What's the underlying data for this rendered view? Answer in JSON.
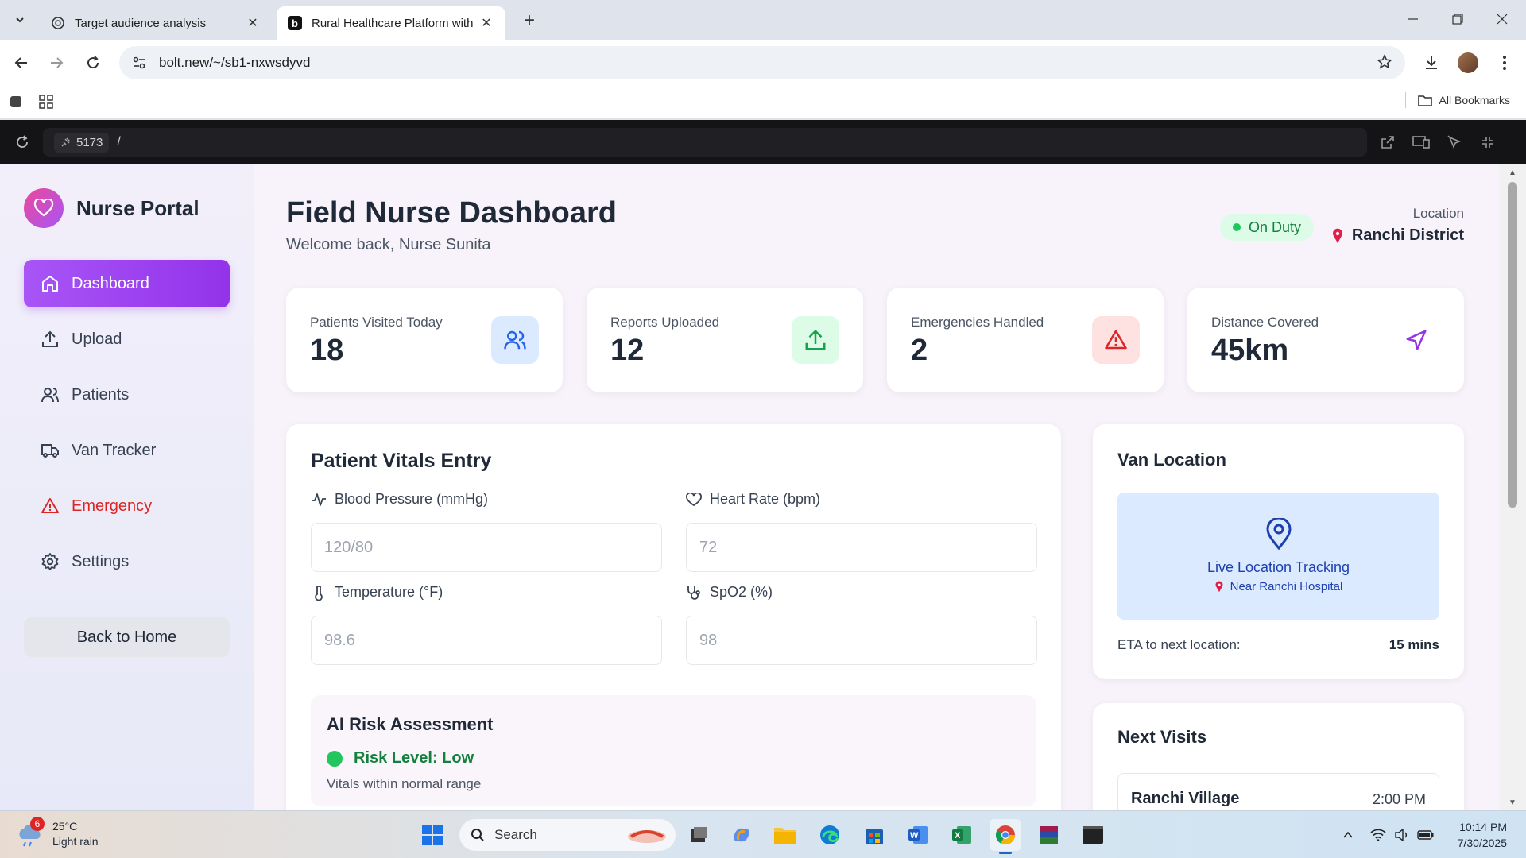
{
  "browser": {
    "tabs": [
      {
        "title": "Target audience analysis",
        "active": false
      },
      {
        "title": "Rural Healthcare Platform with",
        "active": true
      }
    ],
    "url": "bolt.new/~/sb1-nxwsdyvd",
    "bookmarks_label": "All Bookmarks"
  },
  "devbar": {
    "port": "5173",
    "path": "/"
  },
  "sidebar": {
    "brand": "Nurse Portal",
    "items": [
      {
        "label": "Dashboard",
        "icon": "home-icon",
        "active": true
      },
      {
        "label": "Upload",
        "icon": "upload-icon"
      },
      {
        "label": "Patients",
        "icon": "users-icon"
      },
      {
        "label": "Van Tracker",
        "icon": "truck-icon"
      },
      {
        "label": "Emergency",
        "icon": "alert-triangle-icon",
        "danger": true
      },
      {
        "label": "Settings",
        "icon": "gear-icon"
      }
    ],
    "back_home": "Back to Home"
  },
  "header": {
    "title": "Field Nurse Dashboard",
    "subtitle": "Welcome back, Nurse Sunita",
    "status": "On Duty",
    "location_label": "Location",
    "location_value": "Ranchi District"
  },
  "stats": [
    {
      "label": "Patients Visited Today",
      "value": "18",
      "icon": "users-icon",
      "color": "#2563eb",
      "bg": "#dbeafe"
    },
    {
      "label": "Reports Uploaded",
      "value": "12",
      "icon": "upload-icon",
      "color": "#16a34a",
      "bg": "#dcfce7"
    },
    {
      "label": "Emergencies Handled",
      "value": "2",
      "icon": "alert-triangle-icon",
      "color": "#dc2626",
      "bg": "#fee2e2"
    },
    {
      "label": "Distance Covered",
      "value": "45km",
      "icon": "navigation-icon",
      "color": "#9333ea",
      "bg": "#ffffff"
    }
  ],
  "vitals": {
    "title": "Patient Vitals Entry",
    "fields": [
      {
        "label": "Blood Pressure (mmHg)",
        "placeholder": "120/80",
        "icon": "activity-icon"
      },
      {
        "label": "Heart Rate (bpm)",
        "placeholder": "72",
        "icon": "heart-icon"
      },
      {
        "label": "Temperature (°F)",
        "placeholder": "98.6",
        "icon": "thermometer-icon"
      },
      {
        "label": "SpO2 (%)",
        "placeholder": "98",
        "icon": "stethoscope-icon"
      }
    ],
    "risk": {
      "title": "AI Risk Assessment",
      "level": "Risk Level: Low",
      "note": "Vitals within normal range"
    }
  },
  "van": {
    "title": "Van Location",
    "live": "Live Location Tracking",
    "near": "Near Ranchi Hospital",
    "eta_label": "ETA to next location:",
    "eta_value": "15 mins"
  },
  "next_visits": {
    "title": "Next Visits",
    "items": [
      {
        "name": "Ranchi Village",
        "time": "2:00 PM"
      }
    ]
  },
  "taskbar": {
    "temp": "25°C",
    "weather": "Light rain",
    "weather_badge": "6",
    "search": "Search",
    "time": "10:14 PM",
    "date": "7/30/2025"
  },
  "colors": {
    "accent": "#9333ea",
    "success": "#22c55e",
    "danger": "#dc2626"
  }
}
